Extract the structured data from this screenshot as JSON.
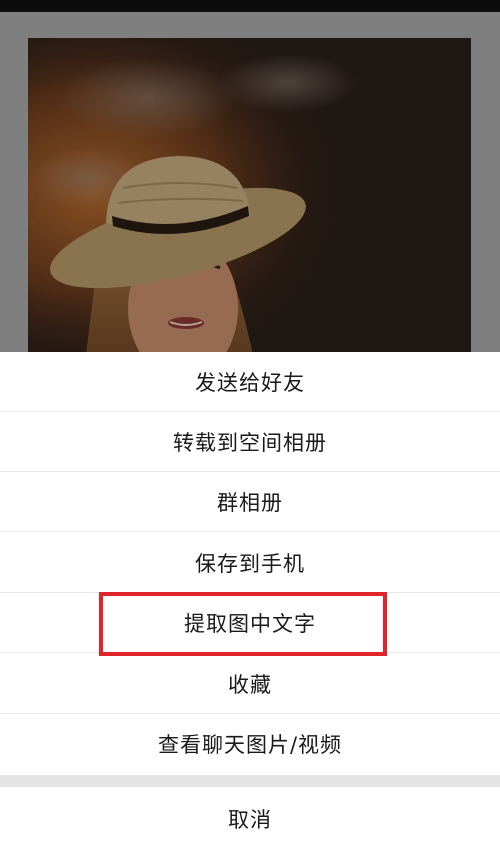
{
  "sheet": {
    "items": [
      {
        "label": "发送给好友"
      },
      {
        "label": "转载到空间相册"
      },
      {
        "label": "群相册"
      },
      {
        "label": "保存到手机"
      },
      {
        "label": "提取图中文字"
      },
      {
        "label": "收藏"
      },
      {
        "label": "查看聊天图片/视频"
      }
    ],
    "cancel_label": "取消"
  },
  "colors": {
    "dim_overlay": "#808080",
    "sheet_background": "#ffffff",
    "highlight": "#e0262b"
  }
}
